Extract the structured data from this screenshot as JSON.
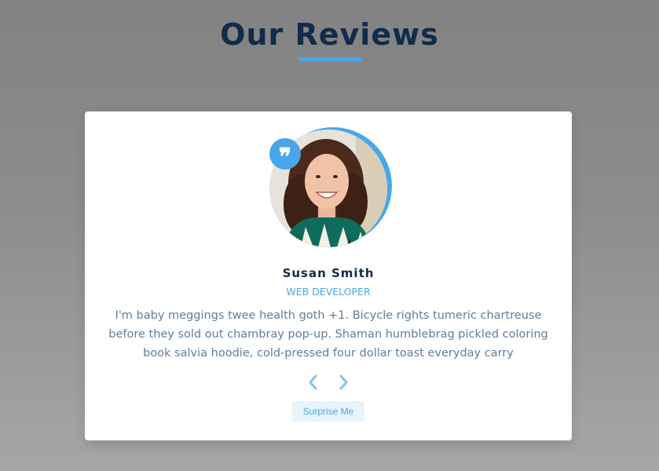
{
  "page": {
    "title": "Our Reviews"
  },
  "review": {
    "quote_icon": "quote-icon",
    "author": "Susan Smith",
    "job": "WEB DEVELOPER",
    "text": "I'm baby meggings twee health goth +1. Bicycle rights tumeric chartreuse before they sold out chambray pop-up. Shaman humblebrag pickled coloring book salvia hoodie, cold-pressed four dollar toast everyday carry"
  },
  "controls": {
    "prev_icon": "chevron-left-icon",
    "next_icon": "chevron-right-icon",
    "random_label": "Surprise Me"
  },
  "colors": {
    "accent": "#49a6e9",
    "title": "#112b4a",
    "text": "#617d98",
    "card": "#ffffff"
  }
}
